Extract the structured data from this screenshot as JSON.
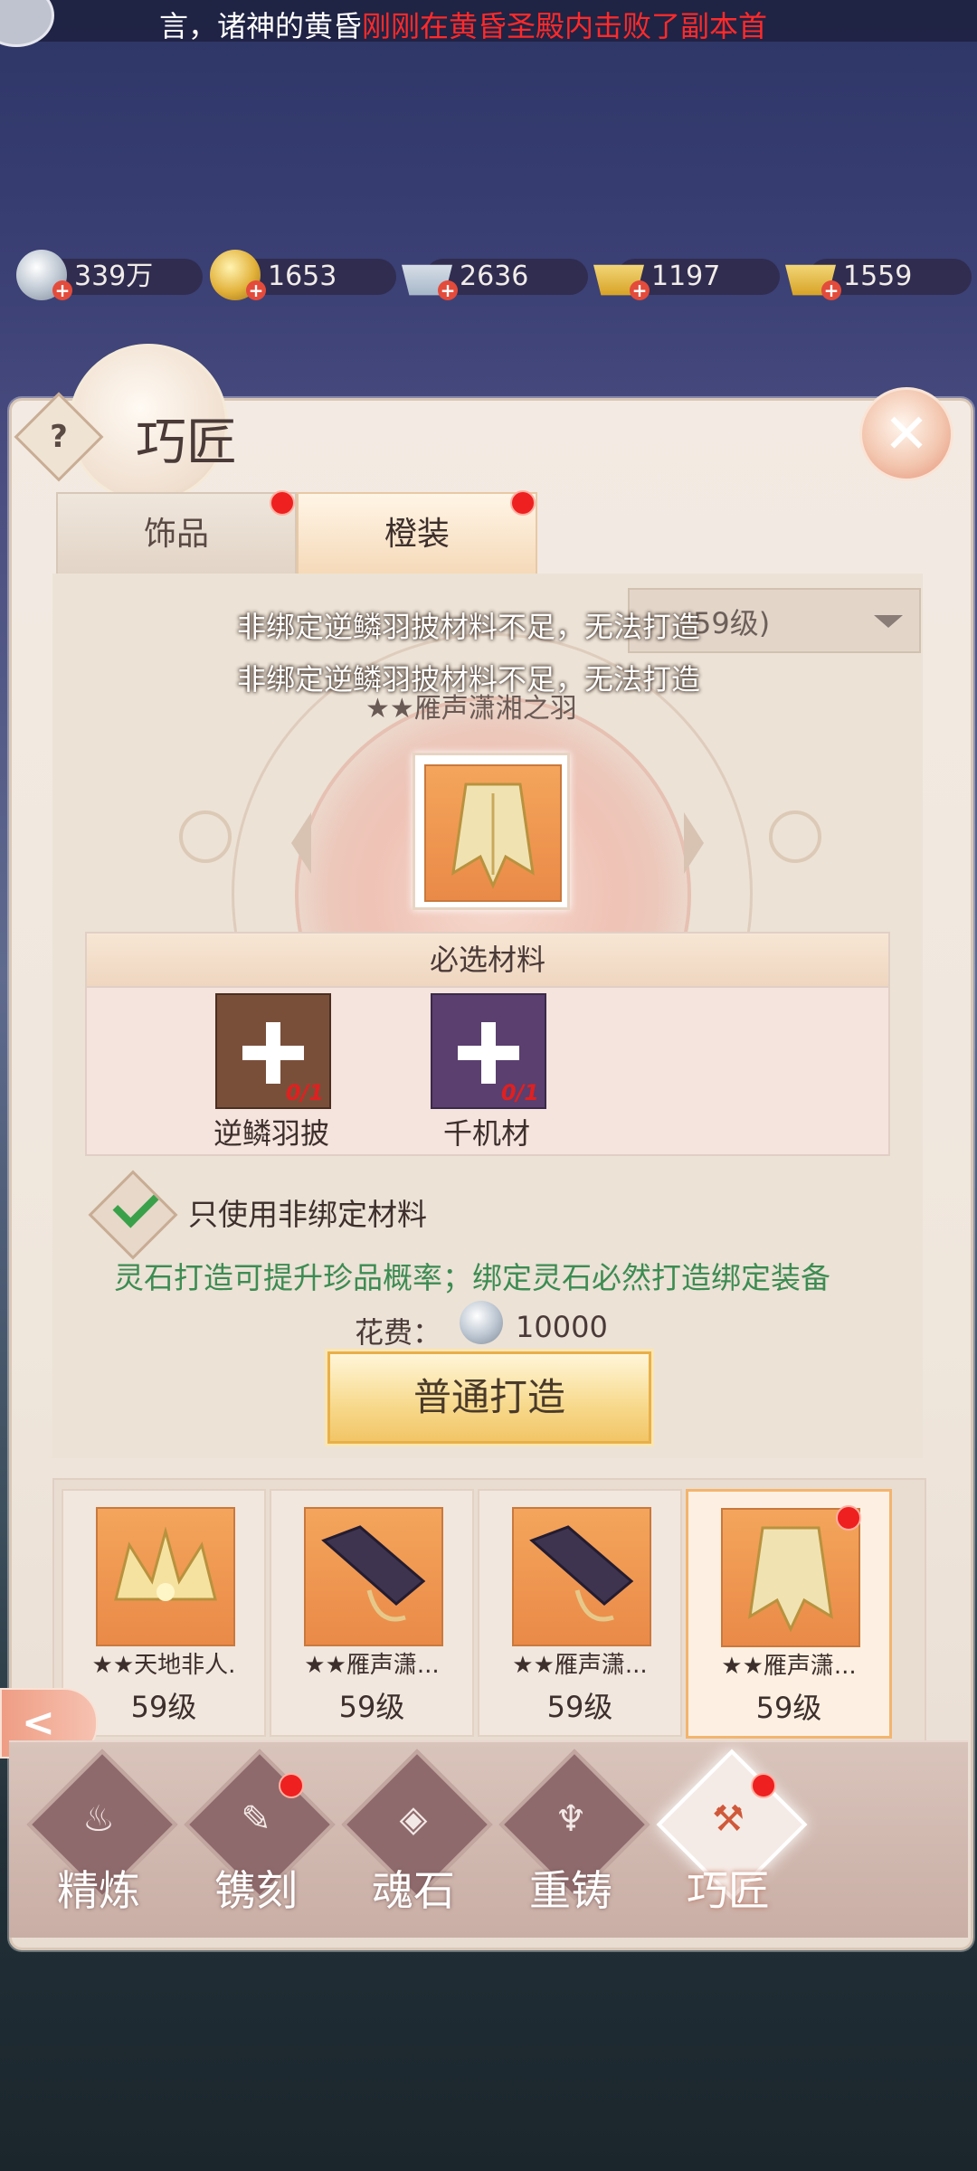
{
  "ticker": {
    "prefix": "言，",
    "guild": "诸神的黄昏",
    "message": "刚刚在黄昏圣殿内击败了副本首"
  },
  "currencies": [
    {
      "icon": "silver-coin-icon",
      "value": "339万"
    },
    {
      "icon": "gold-coin-icon",
      "value": "1653"
    },
    {
      "icon": "silver-ingot-icon",
      "value": "2636"
    },
    {
      "icon": "bound-gold-ingot-icon",
      "value": "1197"
    },
    {
      "icon": "gold-ingot-icon",
      "value": "1559"
    }
  ],
  "panel": {
    "title": "巧匠",
    "help": "?",
    "close": "✕"
  },
  "tabs": [
    {
      "label": "饰品",
      "badge": true
    },
    {
      "label": "橙装",
      "badge": true,
      "active": true
    }
  ],
  "filter": {
    "value": "59级)"
  },
  "messages": [
    "非绑定逆鳞羽披材料不足，无法打造",
    "非绑定逆鳞羽披材料不足，无法打造"
  ],
  "item": {
    "name": "★★雁声潇湘之羽"
  },
  "materials": {
    "header": "必选材料",
    "items": [
      {
        "name": "逆鳞羽披",
        "count": "0/1",
        "color": "#7a4f3a"
      },
      {
        "name": "千机材",
        "count": "0/1",
        "color": "#5a3f6f"
      }
    ]
  },
  "option": {
    "label": "只使用非绑定材料",
    "checked": true
  },
  "hint": "灵石打造可提升珍品概率；绑定灵石必然打造绑定装备",
  "cost": {
    "label": "花费：",
    "value": "10000"
  },
  "forge_button": "普通打造",
  "item_list": [
    {
      "name": "★★天地非人.",
      "level": "59级"
    },
    {
      "name": "★★雁声潇...",
      "level": "59级"
    },
    {
      "name": "★★雁声潇...",
      "level": "59级"
    },
    {
      "name": "★★雁声潇...",
      "level": "59级",
      "selected": true,
      "badge": true
    }
  ],
  "back_symbol": "<",
  "nav": [
    {
      "label": "精炼",
      "symbol": "♨",
      "badge": false
    },
    {
      "label": "镌刻",
      "symbol": "✎",
      "badge": true
    },
    {
      "label": "魂石",
      "symbol": "◈",
      "badge": false
    },
    {
      "label": "重铸",
      "symbol": "♆",
      "badge": false
    },
    {
      "label": "巧匠",
      "symbol": "⚒",
      "badge": true,
      "active": true
    }
  ],
  "colors": {
    "accent": "#f3b46e",
    "badge": "#ee2020",
    "hint": "#3c8c52",
    "count": "#e02020"
  }
}
